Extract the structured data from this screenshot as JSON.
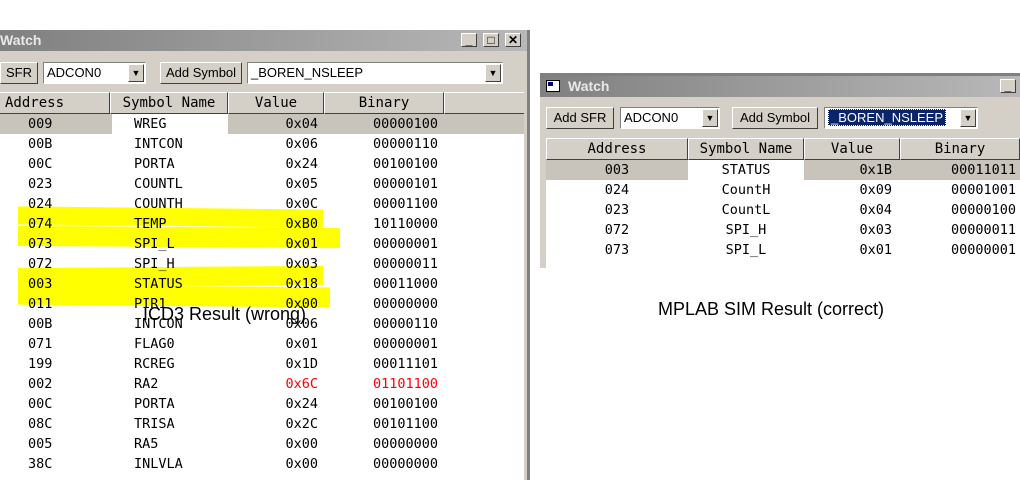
{
  "left": {
    "title": "Watch",
    "sfr_button": "SFR",
    "sfr_select": "ADCON0",
    "add_symbol_button": "Add Symbol",
    "symbol_select": "_BOREN_NSLEEP",
    "columns": [
      "Address",
      "Symbol Name",
      "Value",
      "Binary"
    ],
    "rows": [
      {
        "address": "009",
        "symbol": "WREG",
        "value": "0x04",
        "binary": "00000100"
      },
      {
        "address": "00B",
        "symbol": "INTCON",
        "value": "0x06",
        "binary": "00000110"
      },
      {
        "address": "00C",
        "symbol": "PORTA",
        "value": "0x24",
        "binary": "00100100"
      },
      {
        "address": "023",
        "symbol": "COUNTL",
        "value": "0x05",
        "binary": "00000101"
      },
      {
        "address": "024",
        "symbol": "COUNTH",
        "value": "0x0C",
        "binary": "00001100"
      },
      {
        "address": "074",
        "symbol": "TEMP",
        "value": "0xB0",
        "binary": "10110000"
      },
      {
        "address": "073",
        "symbol": "SPI_L",
        "value": "0x01",
        "binary": "00000001"
      },
      {
        "address": "072",
        "symbol": "SPI_H",
        "value": "0x03",
        "binary": "00000011"
      },
      {
        "address": "003",
        "symbol": "STATUS",
        "value": "0x18",
        "binary": "00011000"
      },
      {
        "address": "011",
        "symbol": "PIR1",
        "value": "0x00",
        "binary": "00000000"
      },
      {
        "address": "00B",
        "symbol": "INTCON",
        "value": "0x06",
        "binary": "00000110"
      },
      {
        "address": "071",
        "symbol": "FLAG0",
        "value": "0x01",
        "binary": "00000001"
      },
      {
        "address": "199",
        "symbol": "RCREG",
        "value": "0x1D",
        "binary": "00011101"
      },
      {
        "address": "002",
        "symbol": "RA2",
        "value": "0x6C",
        "binary": "01101100"
      },
      {
        "address": "00C",
        "symbol": "PORTA",
        "value": "0x24",
        "binary": "00100100"
      },
      {
        "address": "08C",
        "symbol": "TRISA",
        "value": "0x2C",
        "binary": "00101100"
      },
      {
        "address": "005",
        "symbol": "RA5",
        "value": "0x00",
        "binary": "00000000"
      },
      {
        "address": "38C",
        "symbol": "INLVLA",
        "value": "0x00",
        "binary": "00000000"
      }
    ]
  },
  "right": {
    "title": "Watch",
    "add_sfr_button": "Add SFR",
    "sfr_select": "ADCON0",
    "add_symbol_button": "Add Symbol",
    "symbol_select": "_BOREN_NSLEEP",
    "columns": [
      "Address",
      "Symbol Name",
      "Value",
      "Binary"
    ],
    "rows": [
      {
        "address": "003",
        "symbol": "STATUS",
        "value": "0x1B",
        "binary": "00011011"
      },
      {
        "address": "024",
        "symbol": "CountH",
        "value": "0x09",
        "binary": "00001001"
      },
      {
        "address": "023",
        "symbol": "CountL",
        "value": "0x04",
        "binary": "00000100"
      },
      {
        "address": "072",
        "symbol": "SPI_H",
        "value": "0x03",
        "binary": "00000011"
      },
      {
        "address": "073",
        "symbol": "SPI_L",
        "value": "0x01",
        "binary": "00000001"
      }
    ]
  },
  "captions": {
    "left": "ICD3 Result (wrong)",
    "right": "MPLAB SIM Result (correct)"
  },
  "colors": {
    "highlight": "#ffff00",
    "changed_value": "#ff0000",
    "selected_row": "#c8c4bc"
  }
}
